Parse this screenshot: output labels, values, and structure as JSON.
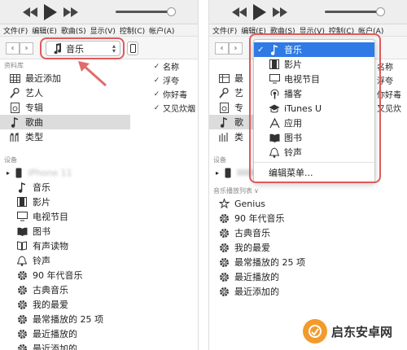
{
  "left": {
    "menu": [
      "文件(F)",
      "编辑(E)",
      "歌曲(S)",
      "显示(V)",
      "控制(C)",
      "帐户(A)"
    ],
    "media_select": "音乐",
    "library_label": "资料库",
    "library": [
      {
        "icon": "grid-icon",
        "label": "最近添加"
      },
      {
        "icon": "artist-icon",
        "label": "艺人"
      },
      {
        "icon": "album-icon",
        "label": "专辑"
      },
      {
        "icon": "music-note-icon",
        "label": "歌曲"
      },
      {
        "icon": "genre-icon",
        "label": "类型"
      }
    ],
    "devices_label": "设备",
    "device_name": "iPhone 11",
    "device_items": [
      {
        "icon": "music-note-icon",
        "label": "音乐"
      },
      {
        "icon": "film-icon",
        "label": "影片"
      },
      {
        "icon": "tv-icon",
        "label": "电视节目"
      },
      {
        "icon": "book-icon",
        "label": "图书"
      },
      {
        "icon": "audiobook-icon",
        "label": "有声读物"
      },
      {
        "icon": "bell-icon",
        "label": "铃声"
      },
      {
        "icon": "gear-icon",
        "label": "90 年代音乐"
      },
      {
        "icon": "gear-icon",
        "label": "古典音乐"
      },
      {
        "icon": "gear-icon",
        "label": "我的最爱"
      },
      {
        "icon": "gear-icon",
        "label": "最常播放的 25 项"
      },
      {
        "icon": "gear-icon",
        "label": "最近播放的"
      },
      {
        "icon": "gear-icon",
        "label": "最近添加的"
      }
    ],
    "songs_header": "名称",
    "songs": [
      "浮夸",
      "你好毒",
      "又见炊烟"
    ]
  },
  "right": {
    "menu": [
      "文件(F)",
      "编辑(E)",
      "歌曲(S)",
      "显示(V)",
      "控制(C)",
      "帐户(A)"
    ],
    "dropdown": [
      {
        "icon": "music-note-icon",
        "label": "音乐",
        "checked": true
      },
      {
        "icon": "film-icon",
        "label": "影片"
      },
      {
        "icon": "tv-icon",
        "label": "电视节目"
      },
      {
        "icon": "podcast-icon",
        "label": "播客"
      },
      {
        "icon": "itunesu-icon",
        "label": "iTunes U"
      },
      {
        "icon": "apps-icon",
        "label": "应用"
      },
      {
        "icon": "book-icon",
        "label": "图书"
      },
      {
        "icon": "bell-icon",
        "label": "铃声"
      }
    ],
    "edit_menu": "编辑菜单...",
    "library_partial": [
      "最",
      "艺",
      "专",
      "歌",
      "类"
    ],
    "devices_label": "设备",
    "playlists_label": "音乐播放列表",
    "playlists": [
      {
        "icon": "genius-icon",
        "label": "Genius"
      },
      {
        "icon": "gear-icon",
        "label": "90 年代音乐"
      },
      {
        "icon": "gear-icon",
        "label": "古典音乐"
      },
      {
        "icon": "gear-icon",
        "label": "我的最爱"
      },
      {
        "icon": "gear-icon",
        "label": "最常播放的 25 项"
      },
      {
        "icon": "gear-icon",
        "label": "最近播放的"
      },
      {
        "icon": "gear-icon",
        "label": "最近添加的"
      }
    ],
    "songs_partial": [
      "名称",
      "浮夸",
      "你好毒",
      "又见炊"
    ]
  },
  "watermark": "启东安卓网",
  "colors": {
    "highlight": "#e05a5a",
    "selected": "#2f7ae5",
    "watermark_logo": "#f29b2c"
  }
}
